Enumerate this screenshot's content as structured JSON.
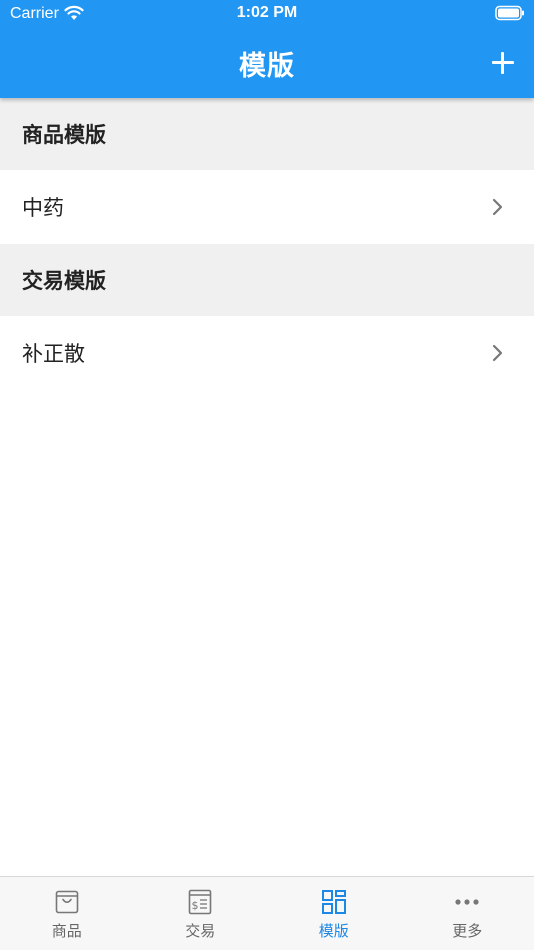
{
  "status_bar": {
    "carrier": "Carrier",
    "time": "1:02 PM"
  },
  "nav": {
    "title": "模版",
    "add_icon": "plus-icon"
  },
  "sections": [
    {
      "header": "商品模版",
      "rows": [
        {
          "label": "中药"
        }
      ]
    },
    {
      "header": "交易模版",
      "rows": [
        {
          "label": "补正散"
        }
      ]
    }
  ],
  "tabs": [
    {
      "label": "商品",
      "icon": "shopping-bag-icon",
      "active": false
    },
    {
      "label": "交易",
      "icon": "receipt-icon",
      "active": false
    },
    {
      "label": "模版",
      "icon": "grid-icon",
      "active": true
    },
    {
      "label": "更多",
      "icon": "more-dots-icon",
      "active": false
    }
  ],
  "colors": {
    "primary": "#2196f3",
    "tab_active": "#1e88e5",
    "section_bg": "#f0f0f0"
  }
}
